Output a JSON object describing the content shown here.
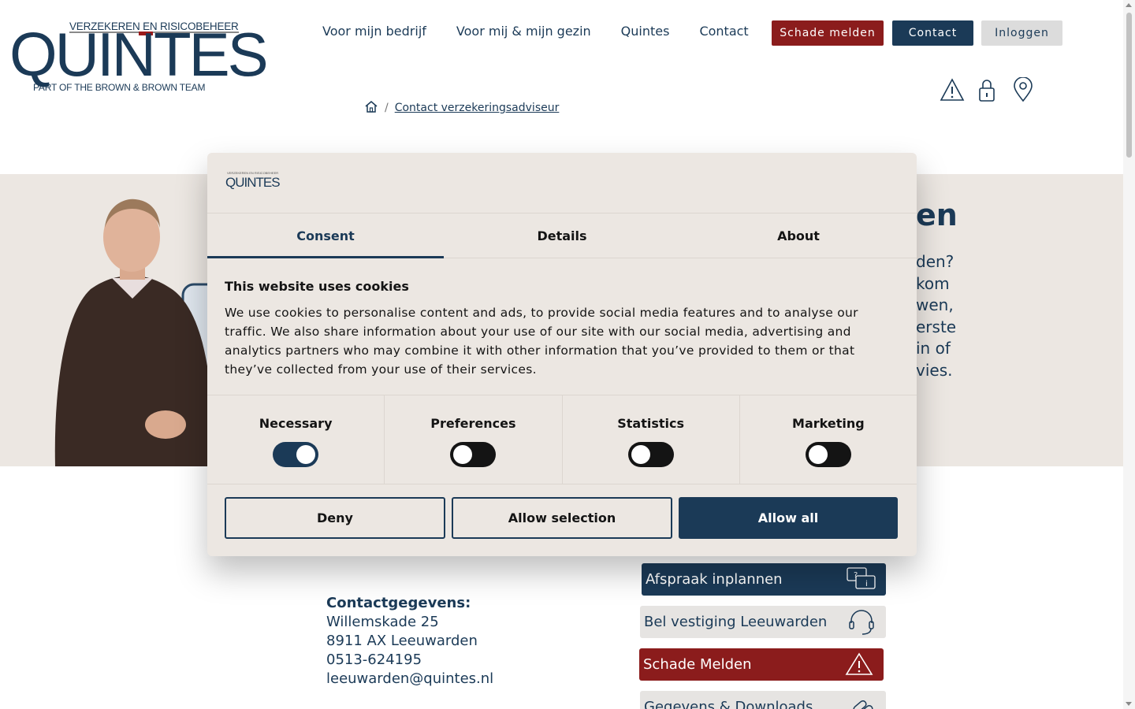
{
  "logo": {
    "tagline_top": "VERZEKEREN EN RISICOBEHEER",
    "wordmark": "QUINTES",
    "tagline_bottom": "PART OF THE BROWN & BROWN TEAM"
  },
  "nav": {
    "items": [
      {
        "label": "Voor mijn bedrijf"
      },
      {
        "label": "Voor mij & mijn gezin"
      },
      {
        "label": "Quintes"
      },
      {
        "label": "Contact"
      }
    ]
  },
  "header_buttons": {
    "schade": "Schade melden",
    "contact": "Contact",
    "login": "Inloggen"
  },
  "header_icons": [
    "warning-icon",
    "lock-icon",
    "location-pin-icon"
  ],
  "breadcrumb": {
    "separator": "/",
    "current": "Contact verzekeringsadviseur"
  },
  "hero": {
    "title_fragment": "en",
    "text_lines": [
      "den?",
      "kom",
      "wen,",
      "erste",
      "in of",
      "vies."
    ]
  },
  "contact": {
    "title": "Contactgegevens:",
    "street": "Willemskade 25",
    "city": "8911 AX Leeuwarden",
    "phone": "0513-624195",
    "email": "leeuwarden@quintes.nl"
  },
  "actions": [
    {
      "label": "Afspraak inplannen",
      "icon": "chat-info-icon"
    },
    {
      "label": "Bel vestiging Leeuwarden",
      "icon": "headset-icon"
    },
    {
      "label": "Schade Melden",
      "icon": "warning-icon"
    },
    {
      "label": "Gegevens & Downloads",
      "icon": "link-icon"
    }
  ],
  "cookie_dialog": {
    "logo_text": "QUINTES",
    "logo_sub": "VERZEKEREN EN RISICOBEHEER",
    "tabs": [
      {
        "label": "Consent",
        "active": true
      },
      {
        "label": "Details",
        "active": false
      },
      {
        "label": "About",
        "active": false
      }
    ],
    "heading": "This website uses cookies",
    "body": "We use cookies to personalise content and ads, to provide social media features and to analyse our traffic. We also share information about your use of our site with our social media, advertising and analytics partners who may combine it with other information that you’ve provided to them or that they’ve collected from your use of their services.",
    "toggles": [
      {
        "label": "Necessary",
        "on": true
      },
      {
        "label": "Preferences",
        "on": false
      },
      {
        "label": "Statistics",
        "on": false
      },
      {
        "label": "Marketing",
        "on": false
      }
    ],
    "buttons": {
      "deny": "Deny",
      "allow_selection": "Allow selection",
      "allow_all": "Allow all"
    }
  },
  "colors": {
    "brand_navy": "#1b3a57",
    "brand_red": "#8b1c1c",
    "dialog_bg": "#ece7e2"
  }
}
